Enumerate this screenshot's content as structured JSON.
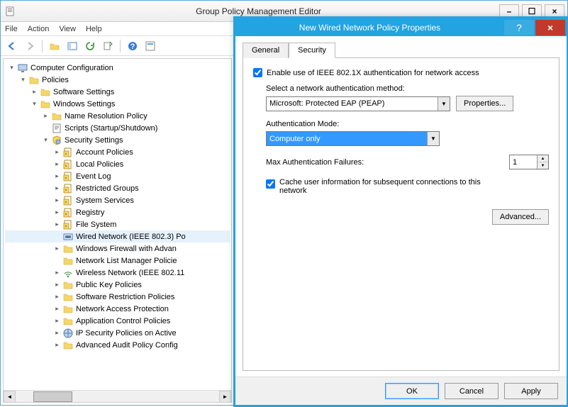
{
  "window": {
    "title": "Group Policy Management Editor",
    "min_icon": "–",
    "max_icon": "☐",
    "close_icon": "×"
  },
  "menu": [
    "File",
    "Action",
    "View",
    "Help"
  ],
  "toolbar_icons": [
    "nav-back-icon",
    "nav-fwd-icon",
    "folder-up-icon",
    "show-hide-icon",
    "refresh-icon",
    "export-icon",
    "help-icon",
    "properties-icon"
  ],
  "tree": [
    {
      "indent": 0,
      "exp": "▿",
      "icon": "computer-icon",
      "label": "Computer Configuration"
    },
    {
      "indent": 1,
      "exp": "▿",
      "icon": "folder-icon",
      "label": "Policies"
    },
    {
      "indent": 2,
      "exp": "▹",
      "icon": "folder-icon",
      "label": "Software Settings"
    },
    {
      "indent": 2,
      "exp": "▿",
      "icon": "folder-icon",
      "label": "Windows Settings"
    },
    {
      "indent": 3,
      "exp": "▹",
      "icon": "folder-icon",
      "label": "Name Resolution Policy"
    },
    {
      "indent": 3,
      "exp": " ",
      "icon": "script-icon",
      "label": "Scripts (Startup/Shutdown)"
    },
    {
      "indent": 3,
      "exp": "▿",
      "icon": "security-icon",
      "label": "Security Settings"
    },
    {
      "indent": 4,
      "exp": "▹",
      "icon": "policy-icon",
      "label": "Account Policies"
    },
    {
      "indent": 4,
      "exp": "▹",
      "icon": "policy-icon",
      "label": "Local Policies"
    },
    {
      "indent": 4,
      "exp": "▹",
      "icon": "policy-icon",
      "label": "Event Log"
    },
    {
      "indent": 4,
      "exp": "▹",
      "icon": "policy-icon",
      "label": "Restricted Groups"
    },
    {
      "indent": 4,
      "exp": "▹",
      "icon": "policy-icon",
      "label": "System Services"
    },
    {
      "indent": 4,
      "exp": "▹",
      "icon": "policy-icon",
      "label": "Registry"
    },
    {
      "indent": 4,
      "exp": "▹",
      "icon": "policy-icon",
      "label": "File System"
    },
    {
      "indent": 4,
      "exp": " ",
      "icon": "wired-icon",
      "label": "Wired Network (IEEE 802.3) Po",
      "sel": true
    },
    {
      "indent": 4,
      "exp": "▹",
      "icon": "folder-icon",
      "label": "Windows Firewall with Advan"
    },
    {
      "indent": 4,
      "exp": " ",
      "icon": "folder-icon",
      "label": "Network List Manager Policie"
    },
    {
      "indent": 4,
      "exp": "▹",
      "icon": "wireless-icon",
      "label": "Wireless Network (IEEE 802.11"
    },
    {
      "indent": 4,
      "exp": "▹",
      "icon": "folder-icon",
      "label": "Public Key Policies"
    },
    {
      "indent": 4,
      "exp": "▹",
      "icon": "folder-icon",
      "label": "Software Restriction Policies"
    },
    {
      "indent": 4,
      "exp": "▹",
      "icon": "folder-icon",
      "label": "Network Access Protection"
    },
    {
      "indent": 4,
      "exp": "▹",
      "icon": "folder-icon",
      "label": "Application Control Policies"
    },
    {
      "indent": 4,
      "exp": "▹",
      "icon": "ipsecurity-icon",
      "label": "IP Security Policies on Active"
    },
    {
      "indent": 4,
      "exp": "▹",
      "icon": "folder-icon",
      "label": "Advanced Audit Policy Config"
    }
  ],
  "dialog": {
    "title": "New Wired Network Policy Properties",
    "help": "?",
    "close": "×",
    "tabs": [
      "General",
      "Security"
    ],
    "active_tab": 1,
    "enable_label": "Enable use of IEEE 802.1X authentication for network access",
    "enable_checked": true,
    "method_label": "Select a network authentication method:",
    "method_value": "Microsoft: Protected EAP (PEAP)",
    "properties_btn": "Properties...",
    "authmode_label": "Authentication Mode:",
    "authmode_value": "Computer only",
    "maxfail_label": "Max Authentication Failures:",
    "maxfail_value": "1",
    "cache_label": "Cache user information for subsequent connections to this network",
    "cache_checked": true,
    "advanced_btn": "Advanced...",
    "ok": "OK",
    "cancel": "Cancel",
    "apply": "Apply"
  }
}
